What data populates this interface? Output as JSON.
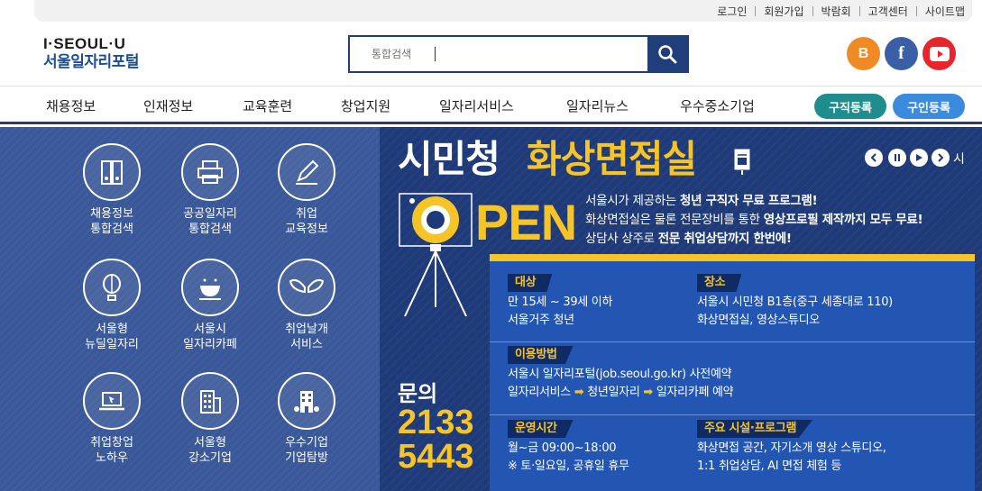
{
  "util_links": [
    "로그인",
    "회원가입",
    "박람회",
    "고객센터",
    "사이트맵"
  ],
  "logo": {
    "top": "I·SEOUL·U",
    "bottom": "서울일자리포털"
  },
  "search": {
    "placeholder": "통합검색",
    "value": ""
  },
  "sns": [
    {
      "label": "B",
      "color": "#f08a25"
    },
    {
      "label": "f",
      "color": "#3b5fa6"
    },
    {
      "label": "▶",
      "color": "#e6262b"
    }
  ],
  "nav": [
    "채용정보",
    "인재정보",
    "교육훈련",
    "창업지원",
    "일자리서비스",
    "일자리뉴스",
    "우수중소기업"
  ],
  "buttons": {
    "job_register": "구직등록",
    "hire_register": "구인등록",
    "job_color": "#1f8d8e",
    "hire_color": "#3a8ade"
  },
  "quick_links": [
    {
      "line1": "채용정보",
      "line2": "통합검색",
      "icon": "binder-icon"
    },
    {
      "line1": "공공일자리",
      "line2": "통합검색",
      "icon": "printer-icon"
    },
    {
      "line1": "취업",
      "line2": "교육정보",
      "icon": "pencil-icon"
    },
    {
      "line1": "서울형",
      "line2": "뉴딜일자리",
      "icon": "balloon-icon"
    },
    {
      "line1": "서울시",
      "line2": "일자리카페",
      "icon": "cafe-icon"
    },
    {
      "line1": "취업날개",
      "line2": "서비스",
      "icon": "wings-icon"
    },
    {
      "line1": "취업창업",
      "line2": "노하우",
      "icon": "laptop-icon"
    },
    {
      "line1": "서울형",
      "line2": "강소기업",
      "icon": "office-building-icon"
    },
    {
      "line1": "우수기업",
      "line2": "기업탐방",
      "icon": "company-building-icon"
    }
  ],
  "banner": {
    "title_white": "시민청",
    "title_yellow": "화상면접실",
    "open": "PEN",
    "desc": [
      {
        "plain": "서울시가 제공하는 ",
        "bold": "청년 구직자 무료 프로그램!"
      },
      {
        "plain": "화상면접실은 물론 전문장비를 통한 ",
        "bold": "영상프로필 제작까지 모두 무료!"
      },
      {
        "plain": "상담사 상주로 ",
        "bold": "전문 취업상담까지 한번에!"
      }
    ],
    "slide_label": "시",
    "inquiry_label": "문의",
    "phone1": "2133",
    "phone2": "5443",
    "info": {
      "target_label": "대상",
      "target_lines": [
        "만 15세 ~ 39세 이하",
        "서울거주 청년"
      ],
      "place_label": "장소",
      "place_lines": [
        "서울시 시민청 B1층(중구 세종대로 110)",
        "화상면접실, 영상스튜디오"
      ],
      "usage_label": "이용방법",
      "usage_line1": "서울시 일자리포털(job.seoul.go.kr) 사전예약",
      "usage_steps": [
        "일자리서비스",
        "청년일자리",
        "일자리카페 예약"
      ],
      "hours_label": "운영시간",
      "hours_lines": [
        "월~금 09:00~18:00",
        "※ 토·일요일, 공휴일 휴무"
      ],
      "facility_label": "주요 시설·프로그램",
      "facility_lines": [
        "화상면접 공간, 자기소개 영상 스튜디오,",
        "1:1 취업상담, AI 면접 체험 등"
      ]
    }
  }
}
